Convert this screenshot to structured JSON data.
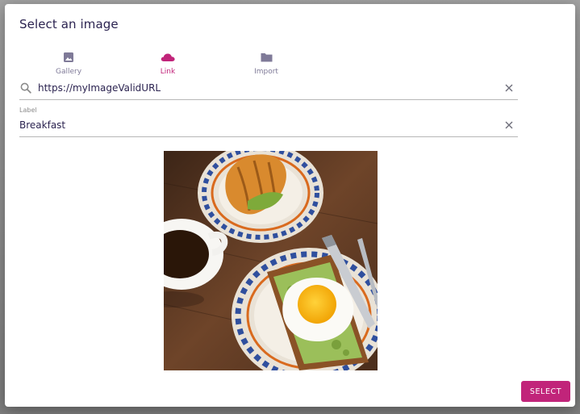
{
  "dialog": {
    "title": "Select an image",
    "tabs": [
      {
        "label": "Gallery",
        "icon": "image-icon",
        "active": false
      },
      {
        "label": "Link",
        "icon": "cloud-icon",
        "active": true
      },
      {
        "label": "Import",
        "icon": "folder-icon",
        "active": false
      }
    ],
    "url_field": {
      "value": "https://myImageValidURL",
      "icon": "search-icon",
      "clear_icon": "close-icon"
    },
    "label_field": {
      "label": "Label",
      "value": "Breakfast",
      "clear_icon": "close-icon"
    },
    "preview": {
      "alt": "Breakfast"
    },
    "select_label": "SELECT"
  },
  "colors": {
    "accent": "#c1247a",
    "title_text": "#2b2350",
    "tab_inactive": "#7f7a98"
  }
}
